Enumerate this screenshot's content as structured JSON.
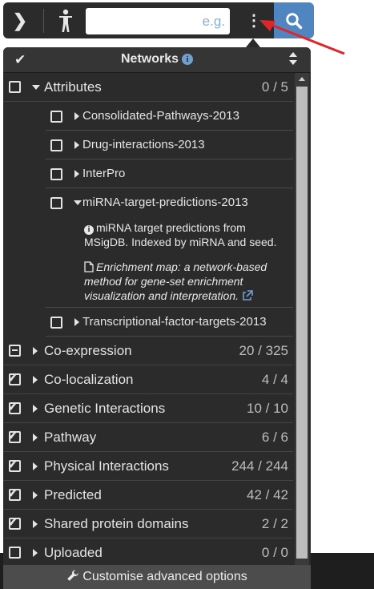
{
  "toolbar": {
    "expand_icon": "chevron-right-icon",
    "organism_icon": "human-figure-icon",
    "search_placeholder": "e.g.",
    "search_value": "",
    "menu_icon": "vertical-ellipsis-icon",
    "search_icon": "search-icon",
    "search_button_color": "#4f86c0"
  },
  "annotation": {
    "arrow_color": "#e0252b"
  },
  "panel": {
    "title": "Networks",
    "groups": [
      {
        "label": "Attributes",
        "count": "0 / 5",
        "state": "unchecked",
        "expanded": true,
        "items": [
          {
            "label": "Consolidated-Pathways-2013",
            "state": "unchecked"
          },
          {
            "label": "Drug-interactions-2013",
            "state": "unchecked"
          },
          {
            "label": "InterPro",
            "state": "unchecked"
          },
          {
            "label": "miRNA-target-predictions-2013",
            "state": "unchecked",
            "expanded": true,
            "description": "miRNA target predictions from MSigDB. Indexed by miRNA and seed.",
            "reference": "Enrichment map: a network-based method for gene-set enrichment visualization and interpretation."
          },
          {
            "label": "Transcriptional-factor-targets-2013",
            "state": "unchecked"
          }
        ]
      },
      {
        "label": "Co-expression",
        "count": "20 / 325",
        "state": "partial"
      },
      {
        "label": "Co-localization",
        "count": "4 / 4",
        "state": "checked"
      },
      {
        "label": "Genetic Interactions",
        "count": "10 / 10",
        "state": "checked"
      },
      {
        "label": "Pathway",
        "count": "6 / 6",
        "state": "checked"
      },
      {
        "label": "Physical Interactions",
        "count": "244 / 244",
        "state": "checked"
      },
      {
        "label": "Predicted",
        "count": "42 / 42",
        "state": "checked"
      },
      {
        "label": "Shared protein domains",
        "count": "2 / 2",
        "state": "checked"
      },
      {
        "label": "Uploaded",
        "count": "0 / 0",
        "state": "unchecked"
      }
    ],
    "footer_label": "Customise advanced options"
  }
}
